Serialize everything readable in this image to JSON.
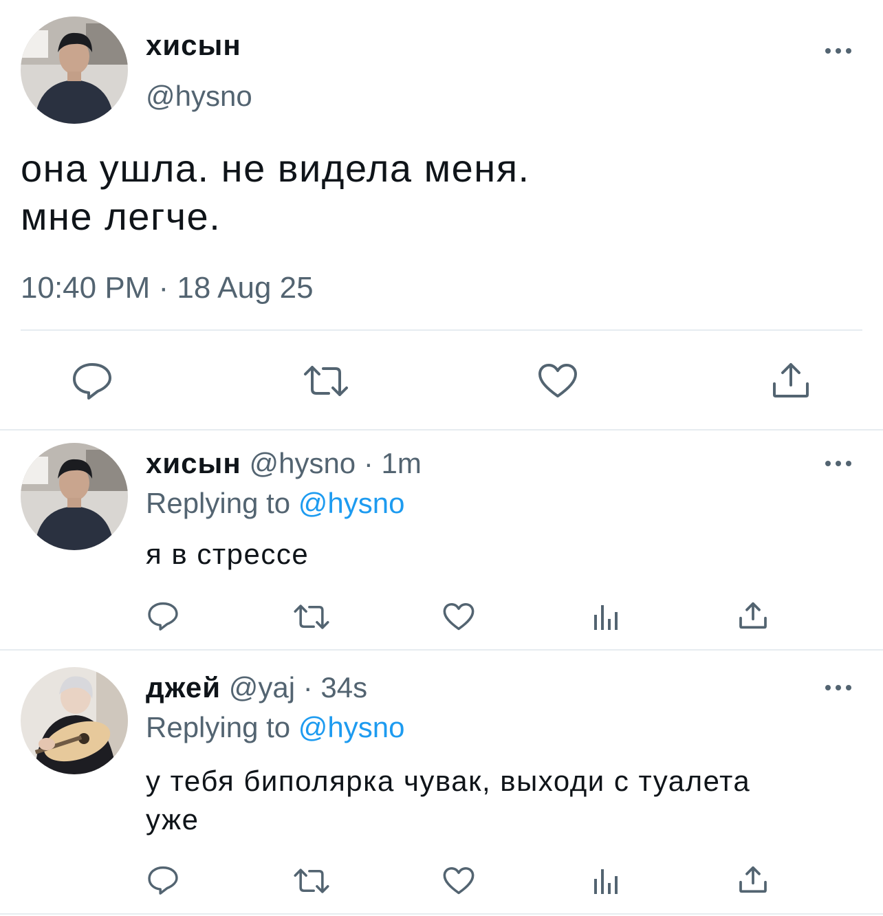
{
  "main_tweet": {
    "display_name": "хисын",
    "handle": "@hysno",
    "text_line1": "она ушла. не видела меня.",
    "text_line2": "мне легче.",
    "timestamp": "10:40 PM · 18 Aug 25",
    "actions": [
      "reply-icon",
      "retweet-icon",
      "like-icon",
      "share-icon"
    ]
  },
  "replies": [
    {
      "display_name": "хисын",
      "handle": "@hysno",
      "sep": "·",
      "time": "1m",
      "replying_label": "Replying to",
      "replying_handle": "@hysno",
      "text_line1": "я в стрессе",
      "text_line2": "",
      "actions": [
        "reply-icon",
        "retweet-icon",
        "like-icon",
        "analytics-icon",
        "share-icon"
      ]
    },
    {
      "display_name": "джей",
      "handle": "@yaj",
      "sep": "·",
      "time": "34s",
      "replying_label": "Replying to",
      "replying_handle": "@hysno",
      "text_line1": "у тебя биполярка чувак, выходи с туалета",
      "text_line2": "уже",
      "actions": [
        "reply-icon",
        "retweet-icon",
        "like-icon",
        "analytics-icon",
        "share-icon"
      ]
    }
  ],
  "colors": {
    "text": "#0f1419",
    "muted": "#536471",
    "link": "#1d9bf0",
    "divider": "#e6ecf0"
  }
}
